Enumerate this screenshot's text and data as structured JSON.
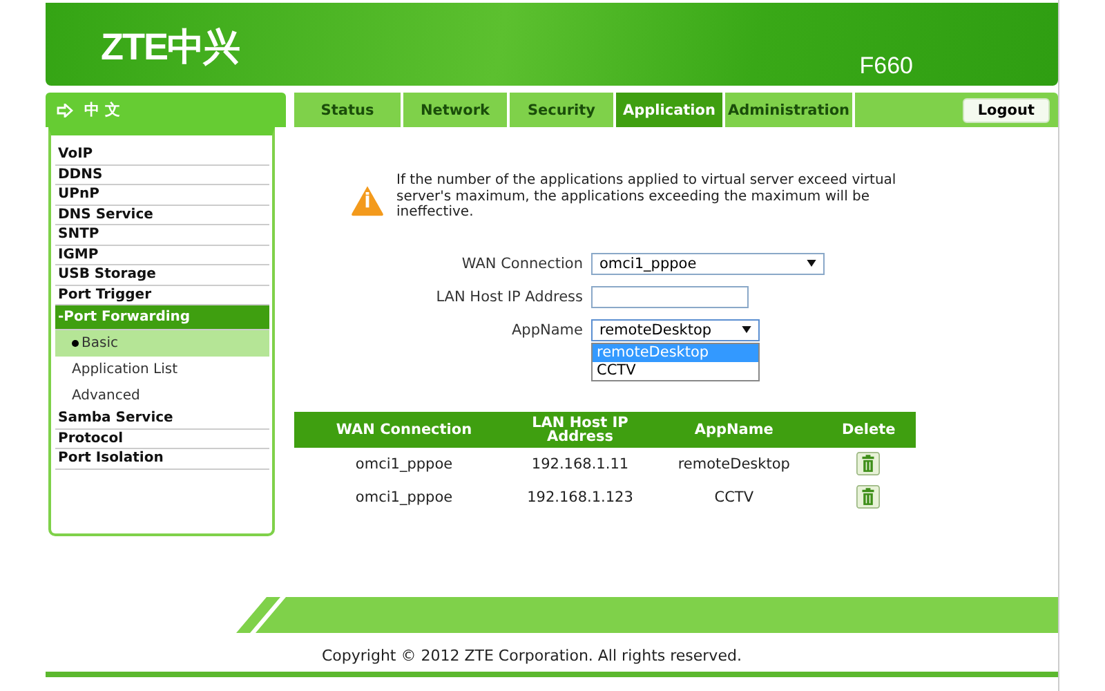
{
  "header": {
    "logo": "ZTE中兴",
    "model": "F660"
  },
  "language": "中 文",
  "tabs": [
    {
      "label": "Status",
      "selected": false
    },
    {
      "label": "Network",
      "selected": false
    },
    {
      "label": "Security",
      "selected": false
    },
    {
      "label": "Application",
      "selected": true
    },
    {
      "label": "Administration",
      "selected": false
    }
  ],
  "logout": "Logout",
  "sidebar": {
    "items": [
      {
        "label": "VoIP",
        "selected": false
      },
      {
        "label": "DDNS",
        "selected": false
      },
      {
        "label": "UPnP",
        "selected": false
      },
      {
        "label": "DNS Service",
        "selected": false
      },
      {
        "label": "SNTP",
        "selected": false
      },
      {
        "label": "IGMP",
        "selected": false
      },
      {
        "label": "USB Storage",
        "selected": false
      },
      {
        "label": "Port Trigger",
        "selected": false
      },
      {
        "label": "-Port Forwarding",
        "selected": true,
        "children": [
          {
            "label": "Basic",
            "selected": true
          },
          {
            "label": "Application List",
            "selected": false
          },
          {
            "label": "Advanced",
            "selected": false
          }
        ]
      },
      {
        "label": "Samba Service",
        "selected": false
      },
      {
        "label": "Protocol",
        "selected": false
      },
      {
        "label": "Port Isolation",
        "selected": false
      }
    ]
  },
  "notice": "If the number of the applications applied to virtual server exceed virtual server's maximum, the applications exceeding the maximum will be ineffective.",
  "form": {
    "wan_connection": {
      "label": "WAN Connection",
      "value": "omci1_pppoe"
    },
    "lan_host_ip": {
      "label": "LAN Host IP Address"
    },
    "app_name": {
      "label": "AppName",
      "value": "remoteDesktop",
      "expanded": true,
      "options": [
        {
          "label": "remoteDesktop",
          "selected": true
        },
        {
          "label": "CCTV",
          "selected": false
        }
      ]
    }
  },
  "table": {
    "columns": [
      "WAN Connection",
      "LAN Host IP Address",
      "AppName",
      "Delete"
    ],
    "rows": [
      [
        "omci1_pppoe",
        "192.168.1.11",
        "remoteDesktop"
      ],
      [
        "omci1_pppoe",
        "192.168.1.123",
        "CCTV"
      ]
    ]
  },
  "footer": "Copyright © 2012 ZTE Corporation. All rights reserved."
}
